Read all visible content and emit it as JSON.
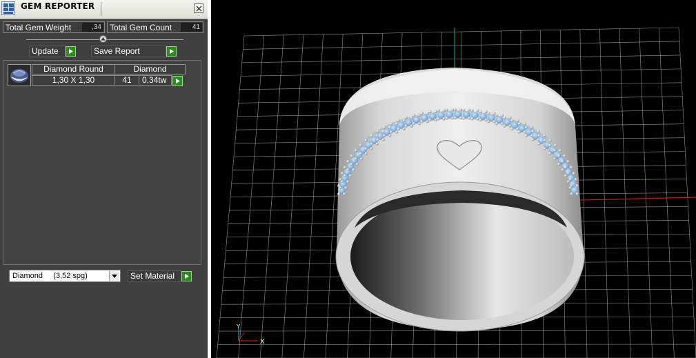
{
  "window": {
    "title": "GEM REPORTER"
  },
  "stats": {
    "total_weight_label": "Total Gem Weight",
    "total_weight_value": ",34",
    "total_count_label": "Total Gem Count",
    "total_count_value": "41"
  },
  "actions": {
    "update_label": "Update",
    "save_report_label": "Save Report"
  },
  "gems": [
    {
      "thumbnail": "gem-round-icon",
      "cut": "Diamond Round",
      "material": "Diamond",
      "size": "1,30 X 1,30",
      "count": "41",
      "weight": "0,34tw"
    }
  ],
  "material_select": {
    "value": "Diamond     (3,52 spg)",
    "set_label": "Set Material"
  },
  "viewport": {
    "axis_x_label": "X",
    "axis_y_label": "Y",
    "axis_colors": {
      "x": "#d0141d",
      "y": "#16a7b8",
      "z": "#d0141d"
    },
    "grid_color": "#c8c8c8",
    "gem_color": "#6aa4d8"
  }
}
